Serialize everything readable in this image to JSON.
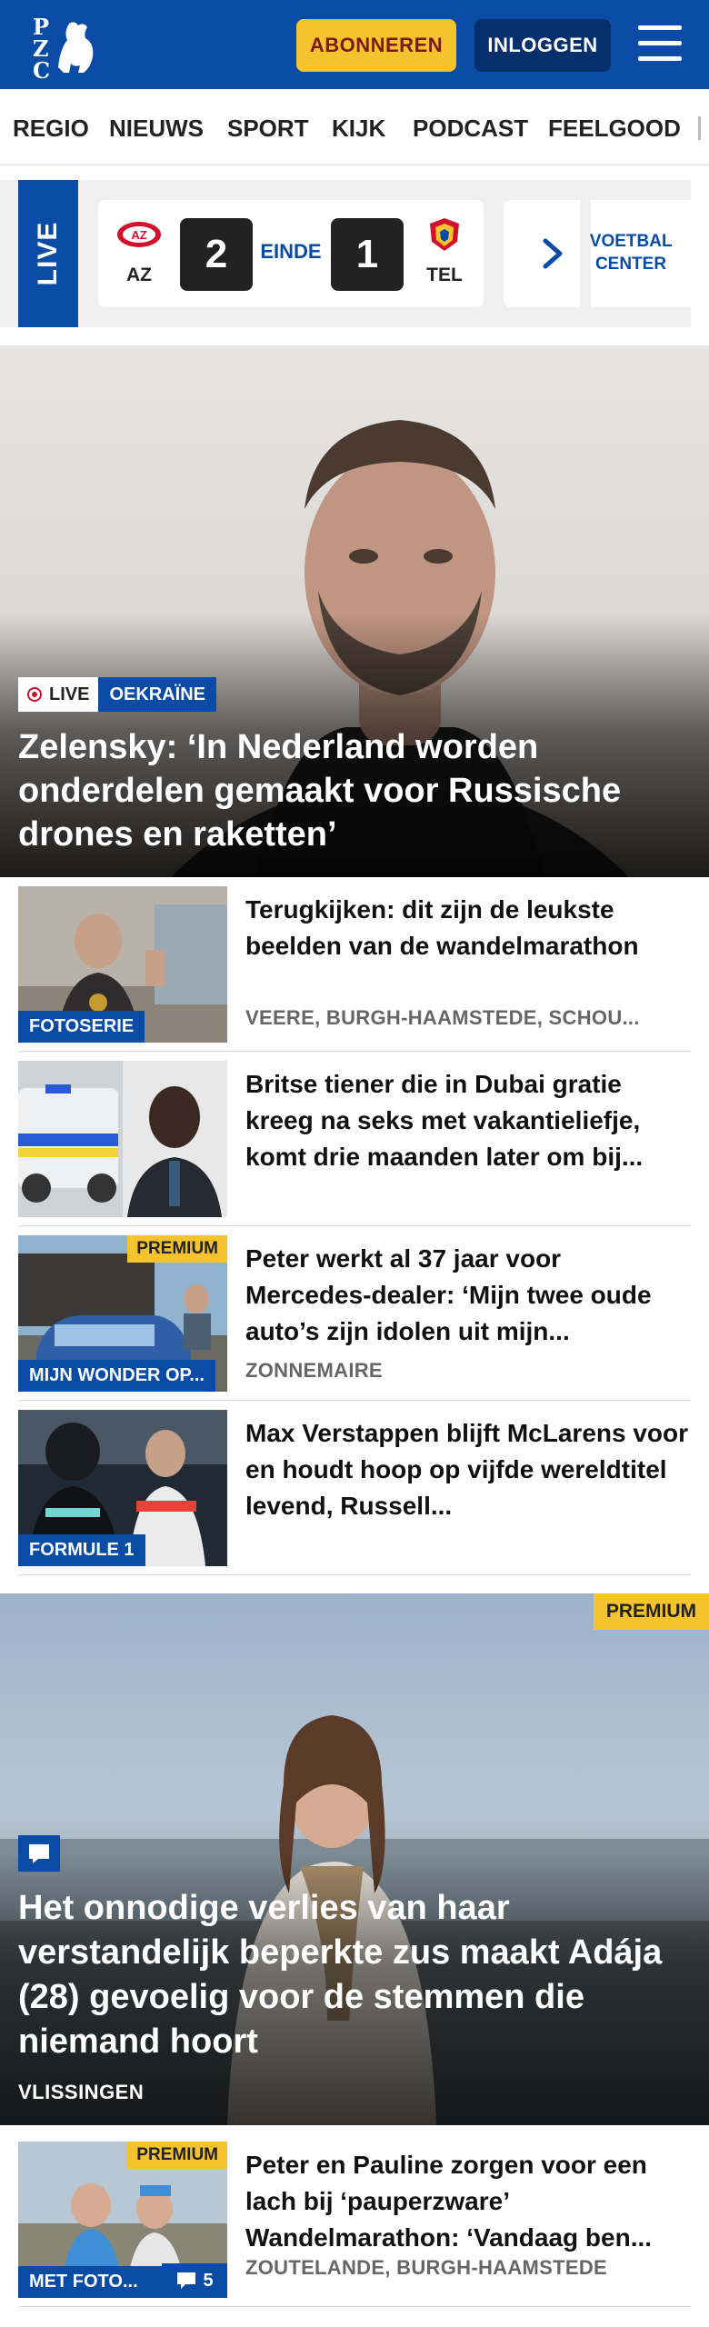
{
  "header": {
    "logo_alt": "PZC",
    "subscribe_label": "ABONNEREN",
    "login_label": "INLOGGEN"
  },
  "nav": {
    "items": [
      "REGIO",
      "NIEUWS",
      "SPORT",
      "KIJK",
      "PODCAST",
      "FEELGOOD"
    ]
  },
  "live_scores": {
    "badge": "LIVE",
    "match": {
      "home_abbr": "AZ",
      "home_score": "2",
      "status": "EINDE",
      "away_score": "1",
      "away_abbr": "TEL"
    },
    "voetbal_center": "VOETBAL CENTER"
  },
  "hero": {
    "live_label": "LIVE",
    "category": "OEKRAÏNE",
    "title": "Zelensky: ‘In Nederland worden onderdelen gemaakt voor Russische drones en raketten’"
  },
  "articles": [
    {
      "thumb_tag": "FOTOSERIE",
      "premium": "",
      "title": "Terugkijken: dit zijn de leukste beelden van de wandelmarathon",
      "meta": "VEERE, BURGH-HAAMSTEDE, SCHOU..."
    },
    {
      "thumb_tag": "",
      "premium": "",
      "title": "Britse tiener die in Dubai gratie kreeg na seks met vakantieliefje, komt drie maanden later om bij...",
      "meta": ""
    },
    {
      "thumb_tag": "MIJN WONDER OP...",
      "premium": "PREMIUM",
      "title": "Peter werkt al 37 jaar voor Mercedes-dealer: ‘Mijn twee oude auto’s zijn idolen uit mijn...",
      "meta": "ZONNEMAIRE"
    },
    {
      "thumb_tag": "FORMULE 1",
      "premium": "",
      "title": "Max Verstappen blijft McLarens voor en houdt hoop op vijfde wereldtitel levend, Russell...",
      "meta": ""
    }
  ],
  "feature": {
    "premium": "PREMIUM",
    "title": "Het onnodige verlies van haar verstandelijk beperkte zus maakt Adája (28) gevoelig voor de stemmen die niemand hoort",
    "location": "VLISSINGEN"
  },
  "last_article": {
    "thumb_tag": "MET FOTO...",
    "comment_count": "5",
    "premium": "PREMIUM",
    "title": "Peter en Pauline zorgen voor een lach bij ‘pauperzware’ Wandelmarathon: ‘Vandaag ben...",
    "meta": "ZOUTELANDE, BURGH-HAAMSTEDE"
  },
  "colors": {
    "brand_blue": "#0a4ba6",
    "brand_navy": "#062f6e",
    "accent_yellow": "#f5c32e",
    "live_red": "#d1102c"
  },
  "icons": {
    "menu": "hamburger-menu-icon",
    "next": "chevron-right-icon",
    "comment": "comment-icon",
    "live": "live-dot-icon"
  }
}
